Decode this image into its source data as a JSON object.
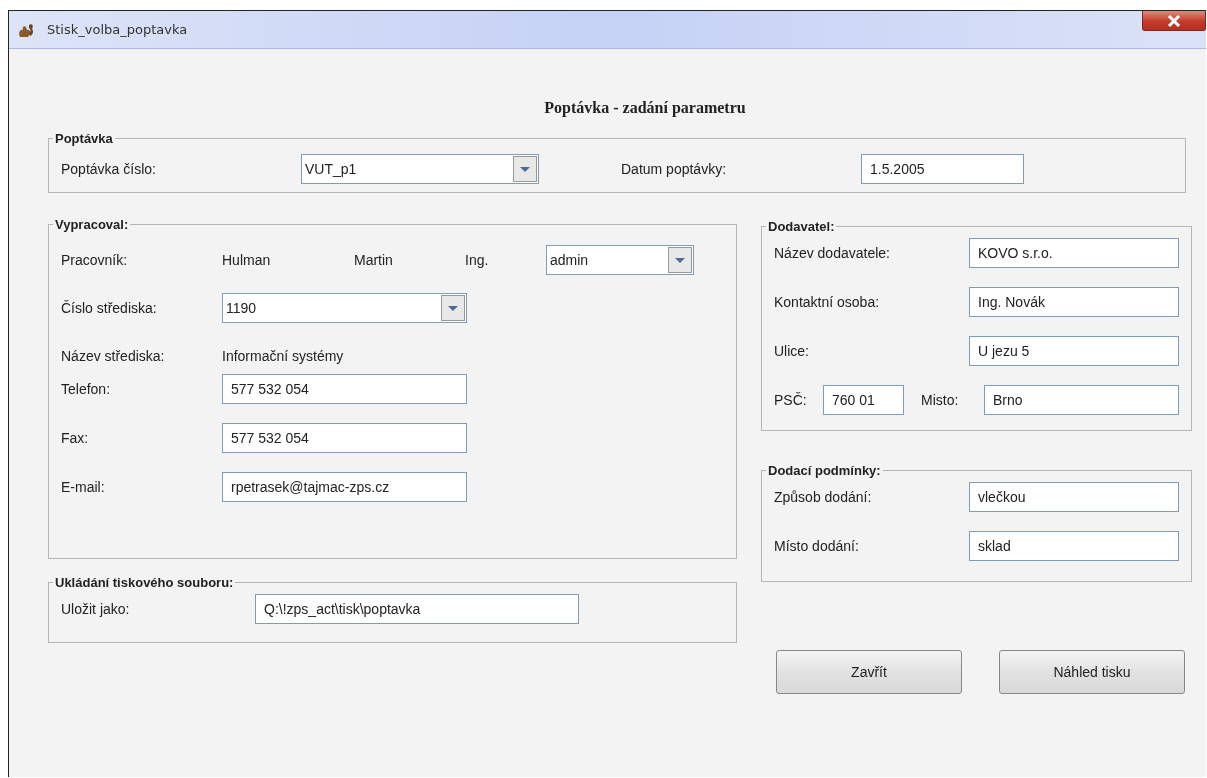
{
  "window": {
    "title": "Stisk_volba_poptavka"
  },
  "heading": "Poptávka - zadání parametru",
  "poptavka": {
    "legend": "Poptávka",
    "number_label": "Poptávka číslo:",
    "number_value": "VUT_p1",
    "date_label": "Datum poptávky:",
    "date_value": "1.5.2005"
  },
  "vypracoval": {
    "legend": "Vypracoval:",
    "worker_label": "Pracovník:",
    "surname": "Hulman",
    "first_name": "Martin",
    "degree": "Ing.",
    "login": "admin",
    "center_label": "Číslo střediska:",
    "center_value": "1190",
    "center_name_label": "Název střediska:",
    "center_name": "Informační systémy",
    "fields": [
      {
        "label": "Telefon:",
        "value": "577 532 054"
      },
      {
        "label": "Fax:",
        "value": "577 532 054"
      },
      {
        "label": "E-mail:",
        "value": "rpetrasek@tajmac-zps.cz"
      }
    ]
  },
  "ukladani": {
    "legend": "Ukládání tiskového souboru:",
    "label": "Uložit jako:",
    "value": "Q:\\!zps_act\\tisk\\poptavka"
  },
  "dodavatel": {
    "legend": "Dodavatel:",
    "fields": [
      {
        "label": "Název dodavatele:",
        "value": "KOVO s.r.o."
      },
      {
        "label": "Kontaktní osoba:",
        "value": "Ing. Novák"
      },
      {
        "label": "Ulice:",
        "value": "U jezu 5"
      }
    ],
    "psc_label": "PSČ:",
    "psc": "760 01",
    "city_label": "Misto:",
    "city": "Brno"
  },
  "dodaci": {
    "legend": "Dodací podmínky:",
    "fields": [
      {
        "label": "Způsob dodání:",
        "value": "vlečkou"
      },
      {
        "label": "Místo dodání:",
        "value": "sklad"
      }
    ]
  },
  "buttons": [
    "Zavřít",
    "Náhled tisku"
  ]
}
